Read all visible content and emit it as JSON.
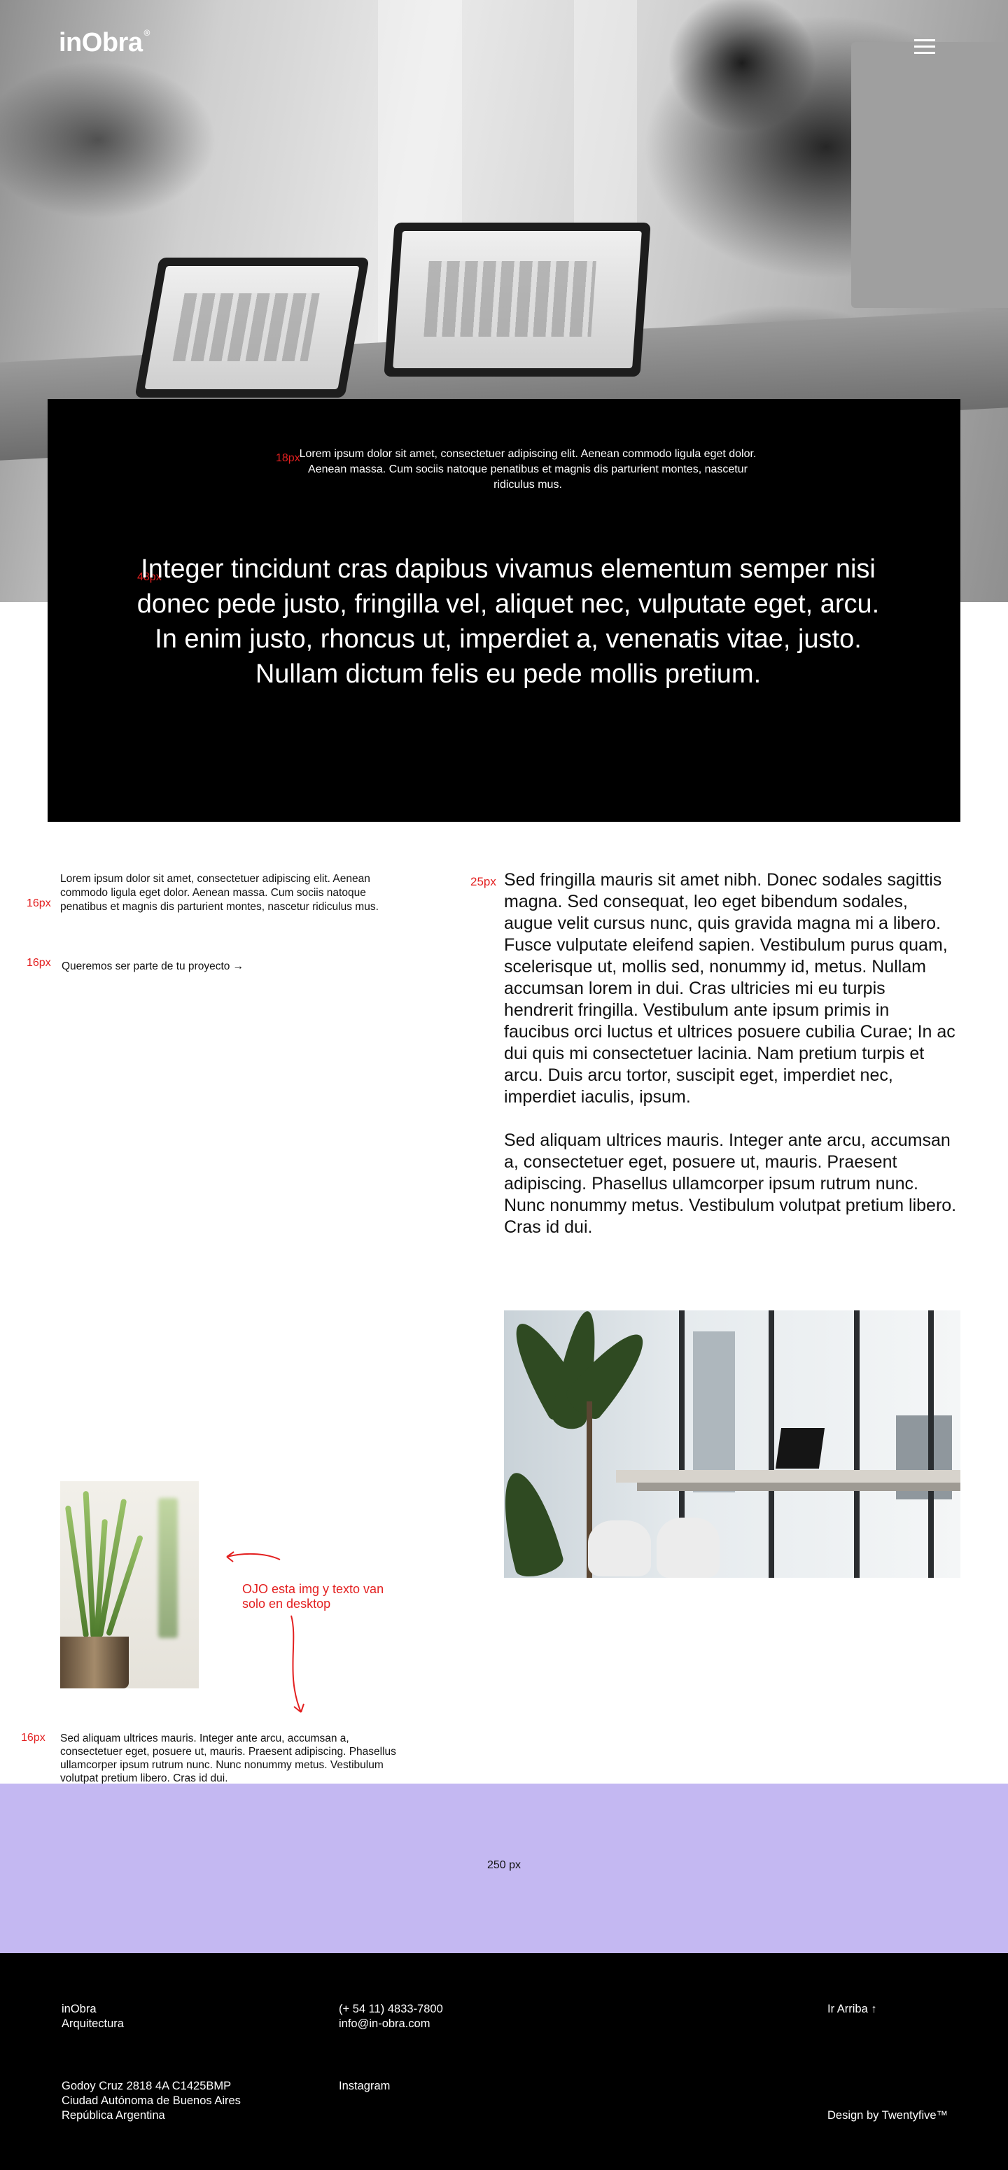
{
  "header": {
    "logo": "inObra",
    "logo_mark": "®",
    "menu_icon": "hamburger-menu-icon"
  },
  "intro": {
    "small_label": "18px",
    "small_text": "Lorem ipsum dolor sit amet, consectetuer adipiscing elit. Aenean commodo ligula eget dolor. Aenean massa. Cum sociis natoque penatibus et magnis dis parturient montes, nascetur ridiculus mus.",
    "big_label": "48px",
    "big_text": "Integer tincidunt cras dapibus vivamus elementum semper nisi donec pede justo, fringilla vel, aliquet nec, vulputate eget, arcu. In enim justo, rhoncus ut, imperdiet a, venenatis vitae, justo. Nullam dictum felis eu pede mollis pretium."
  },
  "left": {
    "text_label": "16px",
    "text": "Lorem ipsum dolor sit amet, consectetuer adipiscing elit. Aenean commodo ligula eget dolor. Aenean massa. Cum sociis natoque penatibus et magnis dis parturient montes, nascetur ridiculus mus.",
    "cta_label": "16px",
    "cta": "Queremos ser parte de tu proyecto →"
  },
  "right": {
    "label": "25px",
    "paragraph1": "Sed fringilla mauris sit amet nibh. Donec sodales sagittis magna. Sed consequat, leo eget bibendum sodales, augue velit cursus nunc, quis gravida magna mi a libero. Fusce vulputate eleifend sapien. Vestibulum purus quam, scelerisque ut, mollis sed, nonummy id, metus. Nullam accumsan lorem in dui. Cras ultricies mi eu turpis hendrerit fringilla. Vestibulum ante ipsum primis in faucibus orci luctus et ultrices posuere cubilia Curae; In ac dui quis mi consectetuer lacinia. Nam pretium turpis et arcu. Duis arcu tortor, suscipit eget, imperdiet nec, imperdiet iaculis, ipsum.",
    "paragraph2": "Sed aliquam ultrices mauris. Integer ante arcu, accumsan a, consectetuer eget, posuere ut, mauris. Praesent adipiscing. Phasellus ullamcorper ipsum rutrum nunc. Nunc nonummy metus. Vestibulum volutpat pretium libero. Cras id dui."
  },
  "note": {
    "text": "OJO esta img y texto van solo en desktop"
  },
  "bottom": {
    "label": "16px",
    "text": "Sed aliquam ultrices mauris. Integer ante arcu, accumsan a, consectetuer eget, posuere ut, mauris. Praesent adipiscing. Phasellus ullamcorper ipsum rutrum nunc. Nunc nonummy metus. Vestibulum volutpat pretium libero. Cras id dui."
  },
  "band": {
    "text": "250 px",
    "color": "#c4b8f2"
  },
  "footer": {
    "brand_line1": "inObra",
    "brand_line2": "Arquitectura",
    "phone": "(+ 54 11) 4833-7800",
    "email": "info@in-obra.com",
    "back_to_top": "Ir Arriba ↑",
    "address_line1": "Godoy Cruz 2818 4A C1425BMP",
    "address_line2": "Ciudad Autónoma de Buenos Aires",
    "address_line3": "República Argentina",
    "instagram": "Instagram",
    "credit": "Design by Twentyfive™"
  },
  "colors": {
    "annotation_red": "#e32020",
    "footer_bg": "#000000",
    "intro_bg": "#000000"
  }
}
